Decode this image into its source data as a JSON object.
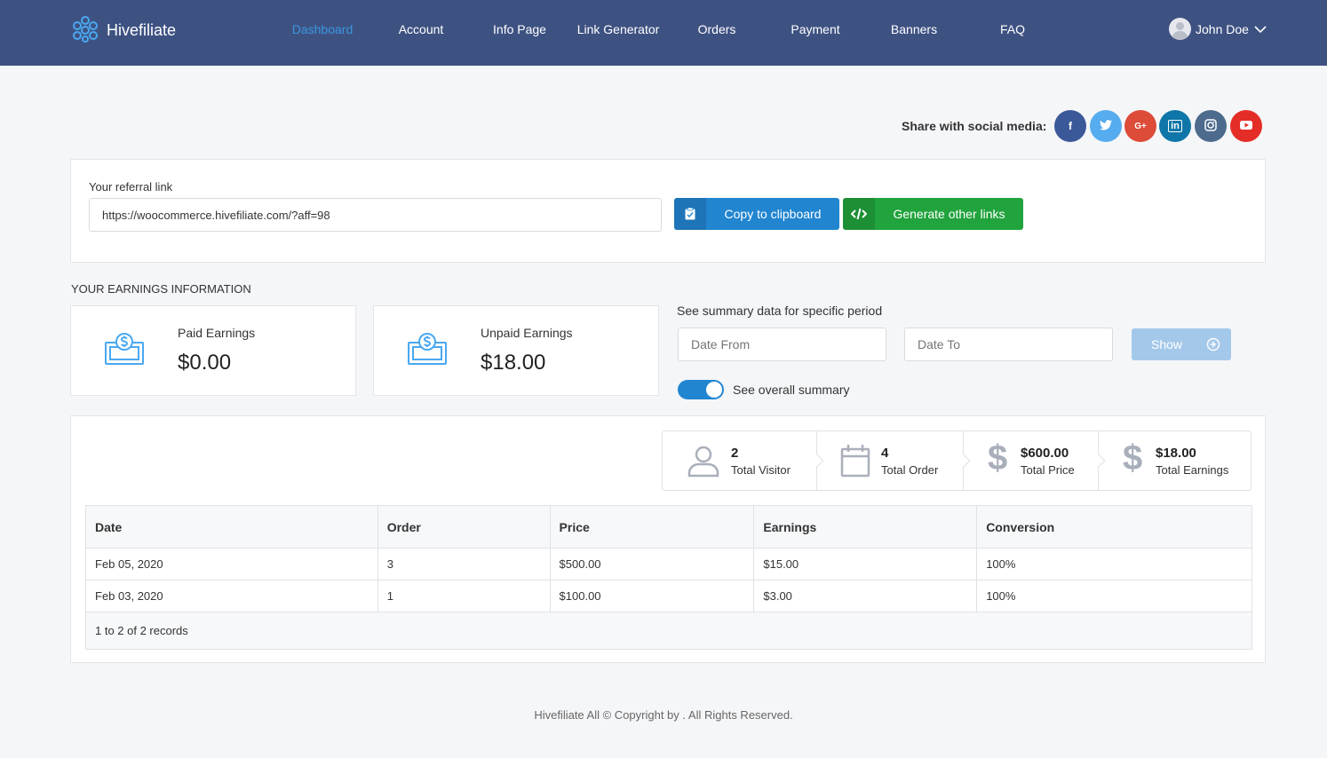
{
  "brand": {
    "name": "Hivefiliate"
  },
  "nav": {
    "items": [
      {
        "label": "Dashboard",
        "active": true
      },
      {
        "label": "Account",
        "active": false
      },
      {
        "label": "Info Page",
        "active": false
      },
      {
        "label": "Link Generator",
        "active": false
      },
      {
        "label": "Orders",
        "active": false
      },
      {
        "label": "Payment",
        "active": false
      },
      {
        "label": "Banners",
        "active": false
      },
      {
        "label": "FAQ",
        "active": false
      }
    ]
  },
  "user": {
    "name": "John Doe"
  },
  "share": {
    "label": "Share with social media:",
    "networks": [
      {
        "icon": "facebook-icon",
        "glyph": "f",
        "color": "#3b5998"
      },
      {
        "icon": "twitter-icon",
        "glyph": "t",
        "color": "#55acee"
      },
      {
        "icon": "google-plus-icon",
        "glyph": "G+",
        "color": "#dd4b39"
      },
      {
        "icon": "linkedin-icon",
        "glyph": "in",
        "color": "#0e76a8"
      },
      {
        "icon": "instagram-icon",
        "glyph": "◎",
        "color": "#4d6b8d"
      },
      {
        "icon": "youtube-icon",
        "glyph": "▶",
        "color": "#e52d27"
      }
    ]
  },
  "referral": {
    "label": "Your referral link",
    "url": "https://woocommerce.hivefiliate.com/?aff=98",
    "copy_label": "Copy to clipboard",
    "generate_label": "Generate other links"
  },
  "earnings": {
    "title": "YOUR EARNINGS INFORMATION",
    "paid_label": "Paid Earnings",
    "paid_value": "$0.00",
    "unpaid_label": "Unpaid Earnings",
    "unpaid_value": "$18.00"
  },
  "period": {
    "label": "See summary data for specific period",
    "date_from_placeholder": "Date From",
    "date_to_placeholder": "Date To",
    "show_label": "Show",
    "overall_label": "See overall summary",
    "overall_on": true
  },
  "stats": {
    "visitors": {
      "value": "2",
      "label": "Total Visitor"
    },
    "orders": {
      "value": "4",
      "label": "Total Order"
    },
    "price": {
      "value": "$600.00",
      "label": "Total Price"
    },
    "earnings": {
      "value": "$18.00",
      "label": "Total Earnings"
    }
  },
  "table": {
    "columns": [
      "Date",
      "Order",
      "Price",
      "Earnings",
      "Conversion"
    ],
    "rows": [
      [
        "Feb 05, 2020",
        "3",
        "$500.00",
        "$15.00",
        "100%"
      ],
      [
        "Feb 03, 2020",
        "1",
        "$100.00",
        "$3.00",
        "100%"
      ]
    ],
    "footer": "1 to 2 of 2 records"
  },
  "footer": {
    "text": "Hivefiliate All © Copyright by . All Rights Reserved."
  },
  "colors": {
    "header": "#3e5282",
    "accent": "#2185d0",
    "success": "#21a33d",
    "active_nav": "#3b95e0"
  }
}
